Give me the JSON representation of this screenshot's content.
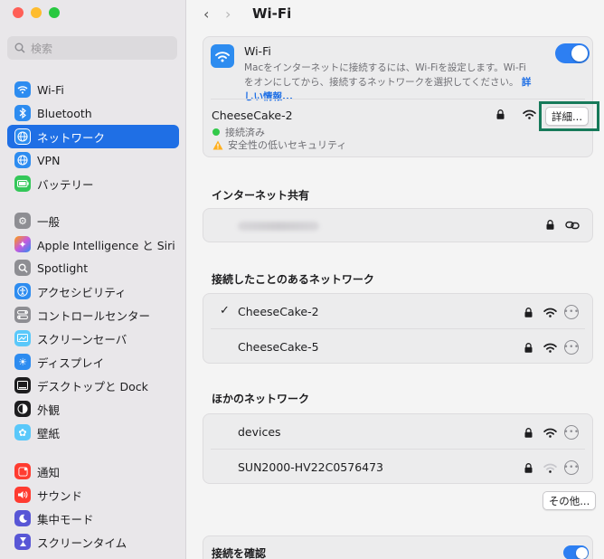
{
  "sidebar": {
    "search_placeholder": "検索",
    "items": [
      {
        "label": "Wi-Fi",
        "icon": "wifi-icon",
        "color": "#2d8cf0"
      },
      {
        "label": "Bluetooth",
        "icon": "bluetooth-icon",
        "color": "#2d8cf0"
      },
      {
        "label": "ネットワーク",
        "icon": "globe-icon",
        "color": "#2d8cf0"
      },
      {
        "label": "VPN",
        "icon": "vpn-globe-icon",
        "color": "#2d8cf0"
      },
      {
        "label": "バッテリー",
        "icon": "battery-icon",
        "color": "#34c759"
      },
      {
        "label": "一般",
        "icon": "gear-icon",
        "color": "#8e8e93"
      },
      {
        "label": "Apple Intelligence と Siri",
        "icon": "siri-icon",
        "color": "#c45adf"
      },
      {
        "label": "Spotlight",
        "icon": "magnifier-icon",
        "color": "#8e8e93"
      },
      {
        "label": "アクセシビリティ",
        "icon": "accessibility-icon",
        "color": "#2d8cf0"
      },
      {
        "label": "コントロールセンター",
        "icon": "control-center-icon",
        "color": "#8e8e93"
      },
      {
        "label": "スクリーンセーバ",
        "icon": "screensaver-icon",
        "color": "#5ac8fa"
      },
      {
        "label": "ディスプレイ",
        "icon": "sun-icon",
        "color": "#2d8cf0"
      },
      {
        "label": "デスクトップと Dock",
        "icon": "dock-icon",
        "color": "#1d1d1f"
      },
      {
        "label": "外観",
        "icon": "appearance-icon",
        "color": "#1d1d1f"
      },
      {
        "label": "壁紙",
        "icon": "wallpaper-icon",
        "color": "#5ac8fa"
      },
      {
        "label": "通知",
        "icon": "bell-icon",
        "color": "#ff3b30"
      },
      {
        "label": "サウンド",
        "icon": "speaker-icon",
        "color": "#ff3b30"
      },
      {
        "label": "集中モード",
        "icon": "moon-icon",
        "color": "#5856d6"
      },
      {
        "label": "スクリーンタイム",
        "icon": "hourglass-icon",
        "color": "#5856d6"
      }
    ]
  },
  "header": {
    "title": "Wi-Fi",
    "back": "‹",
    "forward": "›"
  },
  "wifi_card": {
    "title": "Wi-Fi",
    "description": "Macをインターネットに接続するには、Wi-Fiを設定します。Wi-Fiをオンにしてから、接続するネットワークを選択してください。",
    "link": "詳しい情報...",
    "toggle_on": true,
    "current_network": "CheeseCake-2",
    "status_connected": "接続済み",
    "status_warning": "安全性の低いセキュリティ",
    "details_button": "詳細..."
  },
  "sharing": {
    "title": "インターネット共有"
  },
  "known": {
    "title": "接続したことのあるネットワーク",
    "check": "✓",
    "networks": [
      {
        "name": "CheeseCake-2",
        "selected": true
      },
      {
        "name": "CheeseCake-5",
        "selected": false
      }
    ]
  },
  "other": {
    "title": "ほかのネットワーク",
    "networks": [
      {
        "name": "devices",
        "signal": "strong"
      },
      {
        "name": "SUN2000-HV22C0576473",
        "signal": "weak"
      }
    ],
    "other_button": "その他..."
  },
  "confirm": {
    "title": "接続を確認",
    "toggle_on": true
  },
  "colors": {
    "accent": "#1f6fe5",
    "highlight": "#177a5a"
  }
}
